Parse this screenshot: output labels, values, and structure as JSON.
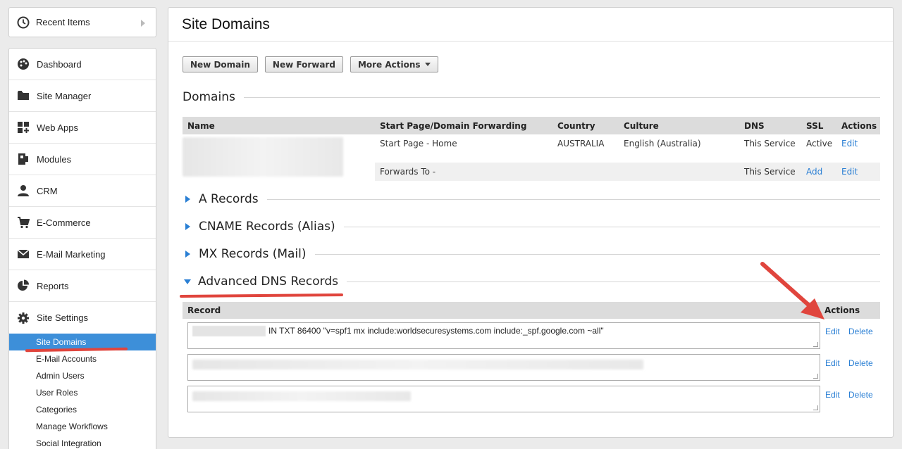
{
  "sidebar": {
    "recent_items_label": "Recent Items",
    "items": [
      {
        "label": "Dashboard",
        "icon": "palette-icon"
      },
      {
        "label": "Site Manager",
        "icon": "folder-icon"
      },
      {
        "label": "Web Apps",
        "icon": "grid-plus-icon"
      },
      {
        "label": "Modules",
        "icon": "modules-icon"
      },
      {
        "label": "CRM",
        "icon": "person-icon"
      },
      {
        "label": "E-Commerce",
        "icon": "cart-icon"
      },
      {
        "label": "E-Mail Marketing",
        "icon": "envelope-icon"
      },
      {
        "label": "Reports",
        "icon": "pie-chart-icon"
      },
      {
        "label": "Site Settings",
        "icon": "gear-icon"
      }
    ],
    "sub_items": [
      "Site Domains",
      "E-Mail Accounts",
      "Admin Users",
      "User Roles",
      "Categories",
      "Manage Workflows",
      "Social Integration"
    ],
    "active_sub_item": "Site Domains"
  },
  "main": {
    "title": "Site Domains",
    "buttons": {
      "new_domain": "New Domain",
      "new_forward": "New Forward",
      "more_actions": "More Actions"
    },
    "domains_section": "Domains",
    "table_headers": [
      "Name",
      "Start Page/Domain Forwarding",
      "Country",
      "Culture",
      "DNS",
      "SSL",
      "Actions"
    ],
    "rows": [
      {
        "forwarding": "Start Page - Home",
        "country": "AUSTRALIA",
        "culture": "English (Australia)",
        "dns": "This Service",
        "ssl": "Active",
        "action": "Edit"
      },
      {
        "forwarding": "Forwards To -",
        "country": "",
        "culture": "",
        "dns": "This Service",
        "ssl": "Add",
        "action": "Edit"
      }
    ],
    "sections": {
      "a_records": "A Records",
      "cname_records": "CNAME Records (Alias)",
      "mx_records": "MX Records (Mail)",
      "advanced_dns": "Advanced DNS Records"
    },
    "dns_table": {
      "header_record": "Record",
      "header_actions": "Actions",
      "records": [
        {
          "text": "IN TXT 86400 \"v=spf1 mx include:worldsecuresystems.com include:_spf.google.com ~all\"",
          "edit": "Edit",
          "delete": "Delete"
        },
        {
          "text": "",
          "edit": "Edit",
          "delete": "Delete"
        },
        {
          "text": "",
          "edit": "Edit",
          "delete": "Delete"
        }
      ]
    }
  },
  "colors": {
    "accent": "#2a7fd4",
    "active_nav": "#3d8fd9",
    "annotation": "#e0453d"
  }
}
